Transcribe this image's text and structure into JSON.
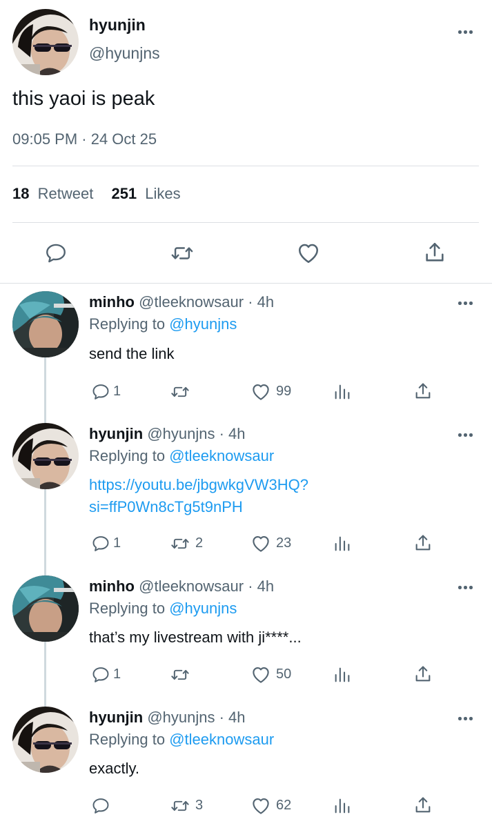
{
  "main_tweet": {
    "display_name": "hyunjin",
    "handle": "@hyunjns",
    "text": "this yaoi is peak",
    "timestamp": "09:05 PM · 24 Oct 25",
    "retweets_count": "18",
    "retweets_label": "Retweet",
    "likes_count": "251",
    "likes_label": "Likes"
  },
  "replies": [
    {
      "display_name": "minho",
      "meta": "@tleeknowsaur · 4h",
      "replying_prefix": "Replying to",
      "replying_to": "@hyunjns",
      "text": "send the link",
      "reply_count": "1",
      "retweet_count": "",
      "like_count": "99"
    },
    {
      "display_name": "hyunjin",
      "meta": "@hyunjns · 4h",
      "replying_prefix": "Replying to",
      "replying_to": "@tleeknowsaur",
      "link_line1": "https://youtu.be/jbgwkgVW3HQ?",
      "link_line2": "si=ffP0Wn8cTg5t9nPH",
      "reply_count": "1",
      "retweet_count": "2",
      "like_count": "23"
    },
    {
      "display_name": "minho",
      "meta": "@tleeknowsaur · 4h",
      "replying_prefix": "Replying to",
      "replying_to": "@hyunjns",
      "text": "that’s my livestream with ji****...",
      "reply_count": "1",
      "retweet_count": "",
      "like_count": "50"
    },
    {
      "display_name": "hyunjin",
      "meta": "@hyunjns · 4h",
      "replying_prefix": "Replying to",
      "replying_to": "@tleeknowsaur",
      "text": "exactly.",
      "reply_count": "",
      "retweet_count": "3",
      "like_count": "62"
    }
  ],
  "icons": {
    "reply": "speech-bubble-icon",
    "retweet": "retweet-arrows-icon",
    "like": "heart-icon",
    "share": "share-upload-icon",
    "views": "bar-chart-icon",
    "more": "more-dots-icon"
  },
  "colors": {
    "link": "#1d9bf0",
    "muted": "#536471",
    "text": "#0f1419"
  }
}
